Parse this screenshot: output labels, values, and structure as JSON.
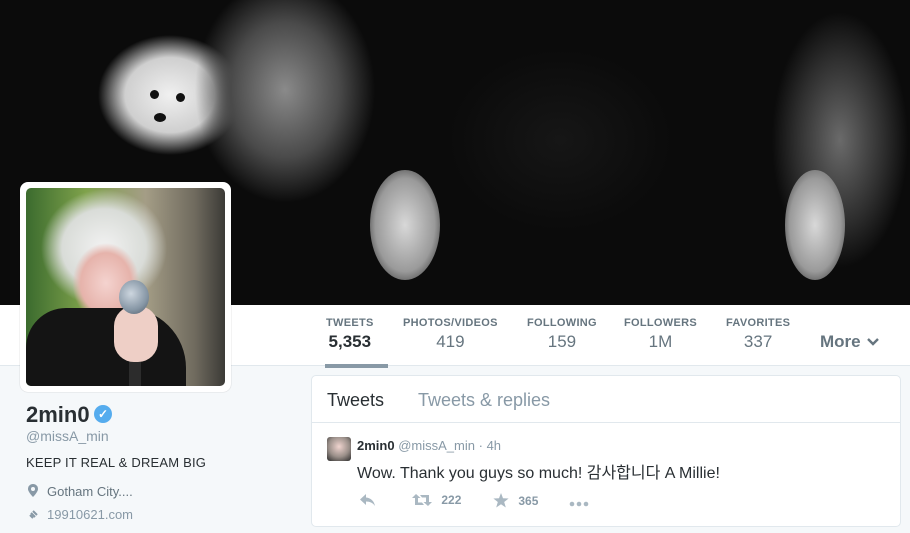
{
  "profile_nav": {
    "stats": [
      {
        "label": "TWEETS",
        "value": "5,353"
      },
      {
        "label": "PHOTOS/VIDEOS",
        "value": "419"
      },
      {
        "label": "FOLLOWING",
        "value": "159"
      },
      {
        "label": "FOLLOWERS",
        "value": "1M"
      },
      {
        "label": "FAVORITES",
        "value": "337"
      }
    ],
    "more_label": "More"
  },
  "profile": {
    "name": "2min0",
    "handle": "@missA_min",
    "bio": "KEEP IT REAL & DREAM BIG",
    "location": "Gotham City....",
    "url": "19910621.com"
  },
  "timeline": {
    "tabs": [
      "Tweets",
      "Tweets & replies"
    ],
    "tweet": {
      "name": "2min0",
      "handle": "@missA_min",
      "separator": "·",
      "time": "4h",
      "text": "Wow. Thank you guys so much! 감사합니다 A Millie!",
      "retweets": "222",
      "favorites": "365"
    }
  },
  "icons": [
    "verified-icon",
    "location-pin-icon",
    "link-icon",
    "reply-icon",
    "retweet-icon",
    "favorite-star-icon",
    "more-dots-icon",
    "chevron-down-icon"
  ],
  "colors": {
    "accent": "#55acee",
    "muted": "#8899a6",
    "text": "#292f33",
    "background": "#f5f8fa"
  }
}
